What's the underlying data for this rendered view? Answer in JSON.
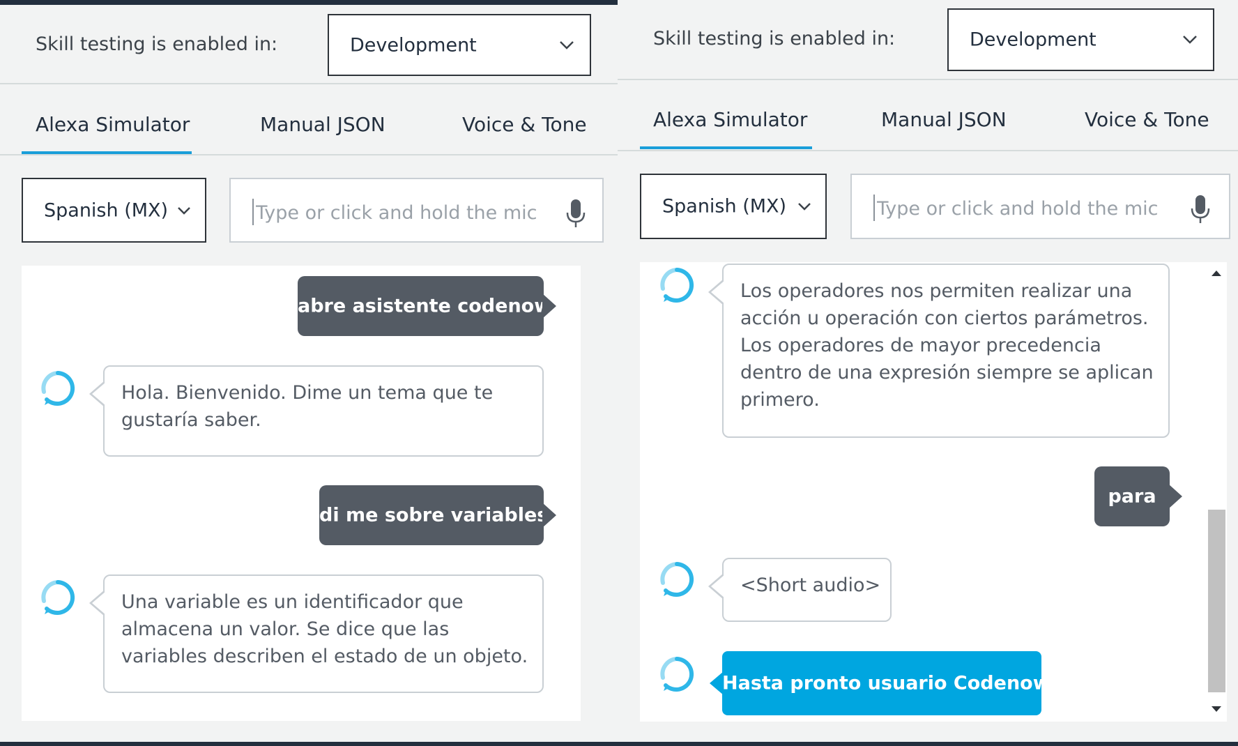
{
  "left": {
    "skill_testing_label": "Skill testing is enabled in:",
    "stage_select": "Development",
    "tabs": [
      {
        "label": "Alexa Simulator",
        "active": true
      },
      {
        "label": "Manual JSON",
        "active": false
      },
      {
        "label": "Voice & Tone",
        "active": false
      }
    ],
    "locale_select": "Spanish (MX)",
    "utterance_placeholder": "Type or click and hold the mic",
    "messages": [
      {
        "from": "user",
        "text": "abre asistente codenow"
      },
      {
        "from": "alexa",
        "text": "Hola. Bienvenido. Dime un tema que te gustaría saber."
      },
      {
        "from": "user",
        "text": "di me sobre variables"
      },
      {
        "from": "alexa",
        "text": "Una variable es un identificador que almacena un valor. Se dice que las variables describen el estado de un objeto."
      }
    ]
  },
  "right": {
    "skill_testing_label": "Skill testing is enabled in:",
    "stage_select": "Development",
    "tabs": [
      {
        "label": "Alexa Simulator",
        "active": true
      },
      {
        "label": "Manual JSON",
        "active": false
      },
      {
        "label": "Voice & Tone",
        "active": false
      }
    ],
    "locale_select": "Spanish (MX)",
    "utterance_placeholder": "Type or click and hold the mic",
    "messages": [
      {
        "from": "alexa",
        "text": "Los operadores nos permiten realizar una acción u operación con ciertos parámetros. Los operadores de mayor precedencia dentro de una expresión siempre se aplican primero."
      },
      {
        "from": "user",
        "text": "para"
      },
      {
        "from": "alexa",
        "text": "<Short audio>"
      },
      {
        "from": "alexa",
        "text": "Hasta pronto usuario Codenow"
      }
    ]
  },
  "colors": {
    "panel_bg": "#f2f3f3",
    "user_bubble": "#545b64",
    "alexa_final_bubble": "#00a6e0",
    "active_tab_underline": "#1a9ed9",
    "alexa_ring": "#2fb7e8"
  },
  "icons": [
    "chevron-down-icon",
    "microphone-icon",
    "alexa-ring-icon",
    "scroll-up-arrow",
    "scroll-down-arrow"
  ]
}
